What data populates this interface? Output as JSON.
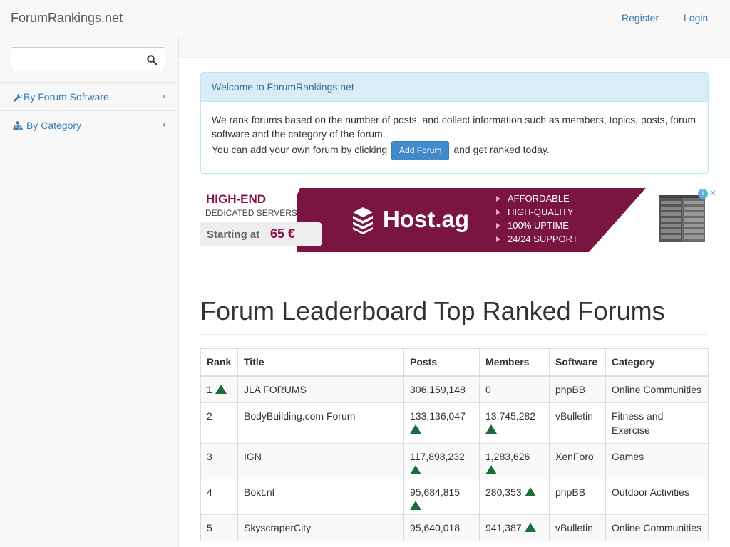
{
  "navbar": {
    "brand": "ForumRankings.net",
    "register": "Register",
    "login": "Login"
  },
  "sidebar": {
    "search": {
      "value": "",
      "placeholder": "",
      "icon": "search-icon"
    },
    "items": [
      {
        "label": "By Forum Software",
        "icon": "wrench-icon"
      },
      {
        "label": "By Category",
        "icon": "sitemap-icon"
      }
    ]
  },
  "welcome": {
    "title": "Welcome to ForumRankings.net",
    "body_1": "We rank forums based on the number of posts, and collect information such as members, topics, posts, forum software and the category of the forum.",
    "body_2_pre": "You can add your own forum by clicking",
    "add_button": "Add Forum",
    "body_2_post": "and get ranked today."
  },
  "ad": {
    "headline": "HIGH-END",
    "subline": "DEDICATED SERVERS",
    "starting": "Starting at",
    "price": "65 €",
    "brand": "Host.ag",
    "features": [
      "AFFORDABLE",
      "HIGH-QUALITY",
      "100% UPTIME",
      "24/24 SUPPORT"
    ],
    "colors": {
      "background": "#7a1440",
      "accent": "#8a1145"
    }
  },
  "leaderboard": {
    "heading": "Forum Leaderboard Top Ranked Forums",
    "columns": [
      "Rank",
      "Title",
      "Posts",
      "Members",
      "Software",
      "Category"
    ],
    "rows": [
      {
        "rank": "1",
        "title": "JLA FORUMS",
        "posts": "306,159,148",
        "members": "0",
        "software": "phpBB",
        "category": "Online Communities"
      },
      {
        "rank": "2",
        "title": "BodyBuilding.com Forum",
        "posts": "133,136,047",
        "members": "13,745,282",
        "software": "vBulletin",
        "category": "Fitness and Exercise"
      },
      {
        "rank": "3",
        "title": "IGN",
        "posts": "117,898,232",
        "members": "1,283,626",
        "software": "XenForo",
        "category": "Games"
      },
      {
        "rank": "4",
        "title": "Bokt.nl",
        "posts": "95,684,815",
        "members": "280,353",
        "software": "phpBB",
        "category": "Outdoor Activities"
      },
      {
        "rank": "5",
        "title": "SkyscraperCity",
        "posts": "95,640,018",
        "members": "941,387",
        "software": "vBulletin",
        "category": "Online Communities"
      }
    ],
    "trend_color": "#1b6e3b"
  }
}
